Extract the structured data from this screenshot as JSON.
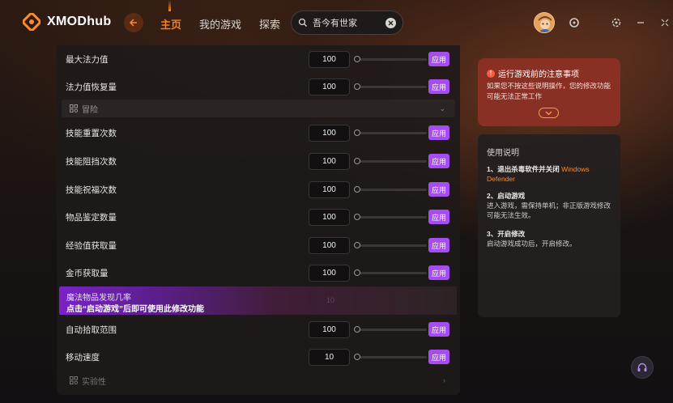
{
  "app": {
    "title": "XMODhub"
  },
  "nav": {
    "items": [
      "主页",
      "我的游戏",
      "探索"
    ]
  },
  "search": {
    "value": "吾今有世家"
  },
  "rows_a": [
    {
      "label": "最大法力值",
      "value": "100",
      "apply": "应用"
    },
    {
      "label": "法力值恢复量",
      "value": "100",
      "apply": "应用"
    }
  ],
  "section_adventure": {
    "label": "冒险"
  },
  "rows_b": [
    {
      "label": "技能重置次数",
      "value": "100",
      "apply": "应用"
    },
    {
      "label": "技能阻挡次数",
      "value": "100",
      "apply": "应用"
    },
    {
      "label": "技能祝福次数",
      "value": "100",
      "apply": "应用"
    },
    {
      "label": "物品鉴定数量",
      "value": "100",
      "apply": "应用"
    },
    {
      "label": "经验值获取量",
      "value": "100",
      "apply": "应用"
    },
    {
      "label": "金币获取量",
      "value": "100",
      "apply": "应用"
    }
  ],
  "locked_row": {
    "title": "魔法物品发现几率",
    "note": "点击“启动游戏”后即可使用此修改功能",
    "value": "10"
  },
  "rows_c": [
    {
      "label": "自动拾取范围",
      "value": "100",
      "apply": "应用"
    },
    {
      "label": "移动速度",
      "value": "10",
      "apply": "应用"
    }
  ],
  "section_experimental": {
    "label": "实验性"
  },
  "warning": {
    "title": "运行游戏前的注意事项",
    "body": "如果您不按这些说明操作，您的修改功能可能无法正常工作"
  },
  "guide": {
    "title": "使用说明",
    "steps": [
      {
        "heading": "1、退出杀毒软件并关闭",
        "highlight": "Windows Defender",
        "text": ""
      },
      {
        "heading": "2、启动游戏",
        "highlight": "",
        "text": "进入游戏，需保持单机；非正版游戏修改可能无法生效。"
      },
      {
        "heading": "3、开启修改",
        "highlight": "",
        "text": "启动游戏成功后，开启修改。"
      }
    ]
  },
  "colors": {
    "accent": "#ff7a1a",
    "apply": "#a64df0",
    "warning_bg": "#8a2f24"
  },
  "icons": [
    "logo-icon",
    "back-icon",
    "search-icon",
    "clear-icon",
    "avatar",
    "controller-icon",
    "settings-icon",
    "minimize-icon",
    "collapse-icon",
    "support-icon"
  ]
}
